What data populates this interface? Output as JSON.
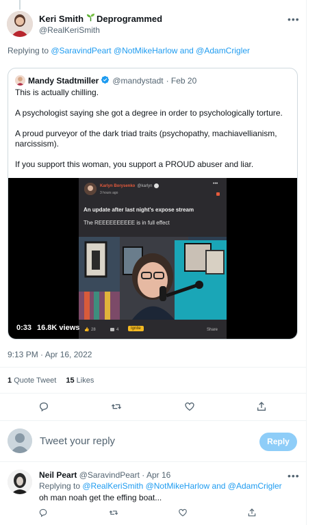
{
  "main_tweet": {
    "author_name": "Keri Smith",
    "author_badge_text": "Deprogrammed",
    "author_handle": "@RealKeriSmith",
    "replying_prefix": "Replying to ",
    "replying_to": "@SaravindPeart @NotMikeHarlow and @AdamCrigler",
    "timestamp": "9:13 PM · Apr 16, 2022",
    "quote_tweet_count": "1",
    "quote_tweet_label": "Quote Tweet",
    "likes_count": "15",
    "likes_label": "Likes"
  },
  "quoted_tweet": {
    "author_name": "Mandy Stadtmiller",
    "author_handle": "@mandystadt",
    "date": "· Feb 20",
    "line1": "This is actually chilling.",
    "line2": "A psychologist saying she got a degree in order to psychologically torture.",
    "line3": "A proud purveyor of the dark triad traits (psychopathy, machiavellianism, narcissism).",
    "line4": "If you support this woman, you support a PROUD abuser and liar."
  },
  "video": {
    "duration": "0:33",
    "views": "16.8K views",
    "inner_name": "Karlyn Borysenko",
    "inner_handle": "@karlyn",
    "inner_time": "3 hours ago",
    "inner_title": "An update after last night's expose stream",
    "inner_subtitle": "The REEEEEEEEEE is in full effect",
    "inner_likes": "28",
    "inner_comments": "4",
    "inner_badge": "Ignite",
    "inner_share": "Share"
  },
  "reply_box": {
    "placeholder": "Tweet your reply",
    "button_label": "Reply"
  },
  "reply_tweet": {
    "author_name": "Neil Peart",
    "author_handle": "@SaravindPeart",
    "date": "· Apr 16",
    "replying_prefix": "Replying to ",
    "replying_to": "@RealKeriSmith @NotMikeHarlow and @AdamCrigler",
    "text": "oh man noah get the effing boat..."
  },
  "colors": {
    "accent": "#1d9bf0",
    "reply_button_bg": "#8ecdf8",
    "verified": "#1d9bf0",
    "video_bg": "#000000"
  }
}
